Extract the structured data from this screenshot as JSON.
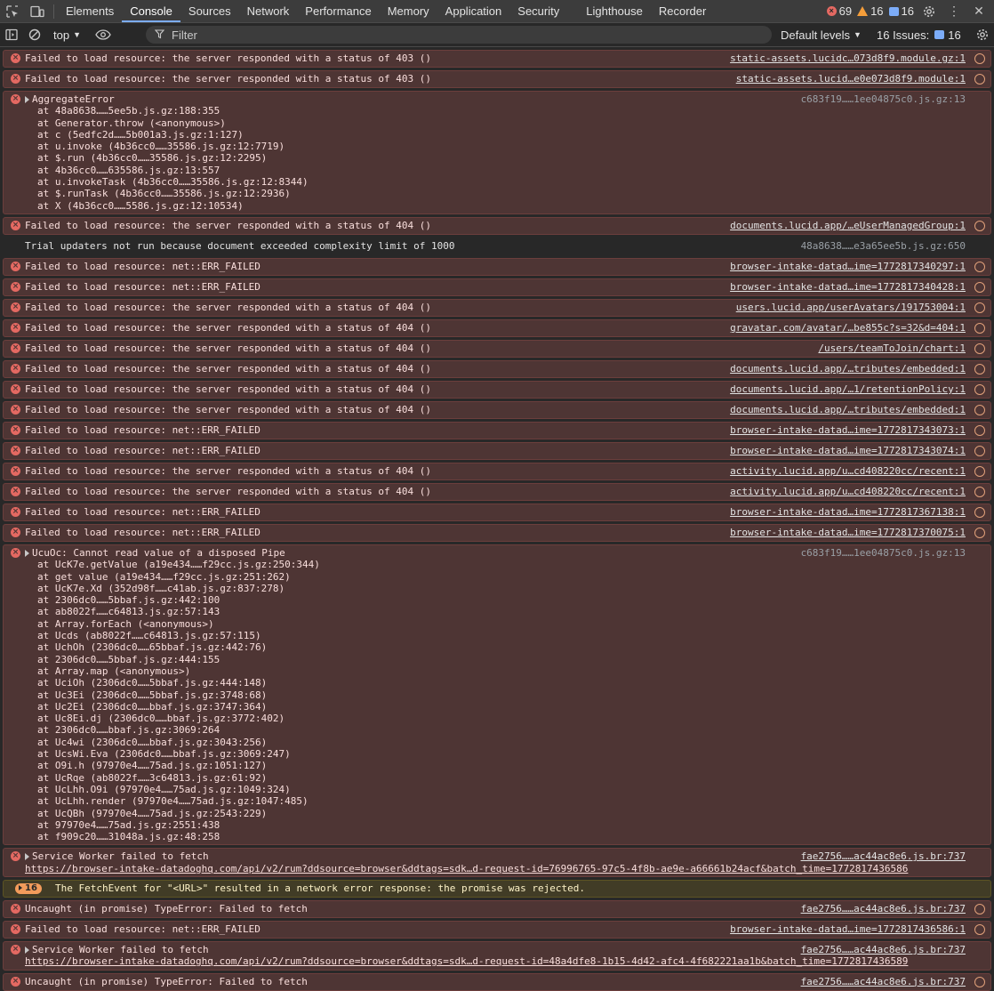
{
  "tabs": [
    "Elements",
    "Console",
    "Sources",
    "Network",
    "Performance",
    "Memory",
    "Application",
    "Security",
    "Lighthouse",
    "Recorder"
  ],
  "active_tab": "Console",
  "counts": {
    "errors": "69",
    "warnings": "16",
    "issues": "16"
  },
  "toolbar": {
    "context": "top",
    "filter_placeholder": "Filter",
    "levels": "Default levels",
    "issues_label": "16 Issues:",
    "issues_count": "16"
  },
  "colors": {
    "error_bg": "#4e3534",
    "warn_bg": "#413c26",
    "accent": "#7cacf8"
  },
  "rows": [
    {
      "type": "error",
      "msg": "Failed to load resource: the server responded with a status of 403 ()",
      "src": "static-assets.lucidc…073d8f9.module.gz:1"
    },
    {
      "type": "error",
      "msg": "Failed to load resource: the server responded with a status of 403 ()",
      "src": "static-assets.lucid…e0e073d8f9.module:1"
    },
    {
      "type": "error-block",
      "head": "AggregateError",
      "src": "c683f19……1ee04875c0.js.gz:13",
      "stack": [
        "at 48a8638……5ee5b.js.gz:188:355",
        "at Generator.throw (<anonymous>)",
        "at c (5edfc2d……5b001a3.js.gz:1:127)",
        "at u.invoke (4b36cc0……35586.js.gz:12:7719)",
        "at $.run (4b36cc0……35586.js.gz:12:2295)",
        "at 4b36cc0……635586.js.gz:13:557",
        "at u.invokeTask (4b36cc0……35586.js.gz:12:8344)",
        "at $.runTask (4b36cc0……35586.js.gz:12:2936)",
        "at X (4b36cc0……5586.js.gz:12:10534)"
      ]
    },
    {
      "type": "error",
      "msg": "Failed to load resource: the server responded with a status of 404 ()",
      "src": "documents.lucid.app/…eUserManagedGroup:1"
    },
    {
      "type": "plain",
      "msg": "Trial updaters not run because document exceeded complexity limit of 1000",
      "src": "48a8638……e3a65ee5b.js.gz:650"
    },
    {
      "type": "error",
      "msg": "Failed to load resource: net::ERR_FAILED",
      "src": "browser-intake-datad…ime=1772817340297:1"
    },
    {
      "type": "error",
      "msg": "Failed to load resource: net::ERR_FAILED",
      "src": "browser-intake-datad…ime=1772817340428:1"
    },
    {
      "type": "error",
      "msg": "Failed to load resource: the server responded with a status of 404 ()",
      "src": "users.lucid.app/userAvatars/191753004:1"
    },
    {
      "type": "error",
      "msg": "Failed to load resource: the server responded with a status of 404 ()",
      "src": "gravatar.com/avatar/…be855c?s=32&d=404:1"
    },
    {
      "type": "error",
      "msg": "Failed to load resource: the server responded with a status of 404 ()",
      "src": "/users/teamToJoin/chart:1"
    },
    {
      "type": "error",
      "msg": "Failed to load resource: the server responded with a status of 404 ()",
      "src": "documents.lucid.app/…tributes/embedded:1"
    },
    {
      "type": "error",
      "msg": "Failed to load resource: the server responded with a status of 404 ()",
      "src": "documents.lucid.app/…1/retentionPolicy:1"
    },
    {
      "type": "error",
      "msg": "Failed to load resource: the server responded with a status of 404 ()",
      "src": "documents.lucid.app/…tributes/embedded:1"
    },
    {
      "type": "error",
      "msg": "Failed to load resource: net::ERR_FAILED",
      "src": "browser-intake-datad…ime=1772817343073:1"
    },
    {
      "type": "error",
      "msg": "Failed to load resource: net::ERR_FAILED",
      "src": "browser-intake-datad…ime=1772817343074:1"
    },
    {
      "type": "error",
      "msg": "Failed to load resource: the server responded with a status of 404 ()",
      "src": "activity.lucid.app/u…cd408220cc/recent:1"
    },
    {
      "type": "error",
      "msg": "Failed to load resource: the server responded with a status of 404 ()",
      "src": "activity.lucid.app/u…cd408220cc/recent:1"
    },
    {
      "type": "error",
      "msg": "Failed to load resource: net::ERR_FAILED",
      "src": "browser-intake-datad…ime=1772817367138:1"
    },
    {
      "type": "error",
      "msg": "Failed to load resource: net::ERR_FAILED",
      "src": "browser-intake-datad…ime=1772817370075:1"
    },
    {
      "type": "error-block",
      "head": "UcuOc: Cannot read value of a disposed Pipe",
      "src": "c683f19……1ee04875c0.js.gz:13",
      "stack": [
        "at UcK7e.getValue (a19e434……f29cc.js.gz:250:344)",
        "at get value (a19e434……f29cc.js.gz:251:262)",
        "at UcK7e.Xd (352d98f……c41ab.js.gz:837:278)",
        "at 2306dc0……5bbaf.js.gz:442:100",
        "at ab8022f……c64813.js.gz:57:143",
        "at Array.forEach (<anonymous>)",
        "at Ucds (ab8022f……c64813.js.gz:57:115)",
        "at UchOh (2306dc0……65bbaf.js.gz:442:76)",
        "at 2306dc0……5bbaf.js.gz:444:155",
        "at Array.map (<anonymous>)",
        "at UciOh (2306dc0……5bbaf.js.gz:444:148)",
        "at Uc3Ei (2306dc0……5bbaf.js.gz:3748:68)",
        "at Uc2Ei (2306dc0……bbaf.js.gz:3747:364)",
        "at Uc8Ei.dj (2306dc0……bbaf.js.gz:3772:402)",
        "at 2306dc0……bbaf.js.gz:3069:264",
        "at Uc4wi (2306dc0……bbaf.js.gz:3043:256)",
        "at UcsWi.Eva (2306dc0……bbaf.js.gz:3069:247)",
        "at O9i.h (97970e4……75ad.js.gz:1051:127)",
        "at UcRqe (ab8022f……3c64813.js.gz:61:92)",
        "at UcLhh.O9i (97970e4……75ad.js.gz:1049:324)",
        "at UcLhh.render (97970e4……75ad.js.gz:1047:485)",
        "at UcQBh (97970e4……75ad.js.gz:2543:229)",
        "at 97970e4……75ad.js.gz:2551:438",
        "at f909c20……31048a.js.gz:48:258"
      ]
    },
    {
      "type": "error-url",
      "head": "Service Worker failed to fetch",
      "src": "fae2756……ac44ac8e6.js.br:737",
      "url": "https://browser-intake-datadoghq.com/api/v2/rum?ddsource=browser&ddtags=sdk…d-request-id=76996765-97c5-4f8b-ae9e-a66661b24acf&batch_time=1772817436586"
    },
    {
      "type": "warn",
      "badge": "16",
      "msg": "The FetchEvent for \"<URL>\" resulted in a network error response: the promise was rejected."
    },
    {
      "type": "error",
      "msg": "Uncaught (in promise) TypeError: Failed to fetch",
      "src": "fae2756……ac44ac8e6.js.br:737",
      "plainsrc": true
    },
    {
      "type": "error",
      "msg": "Failed to load resource: net::ERR_FAILED",
      "src": "browser-intake-datad…ime=1772817436586:1"
    },
    {
      "type": "error-url",
      "head": "Service Worker failed to fetch",
      "src": "fae2756……ac44ac8e6.js.br:737",
      "url": "https://browser-intake-datadoghq.com/api/v2/rum?ddsource=browser&ddtags=sdk…d-request-id=48a4dfe8-1b15-4d42-afc4-4f682221aa1b&batch_time=1772817436589"
    },
    {
      "type": "error",
      "msg": "Uncaught (in promise) TypeError: Failed to fetch",
      "src": "fae2756……ac44ac8e6.js.br:737",
      "plainsrc": true
    }
  ]
}
